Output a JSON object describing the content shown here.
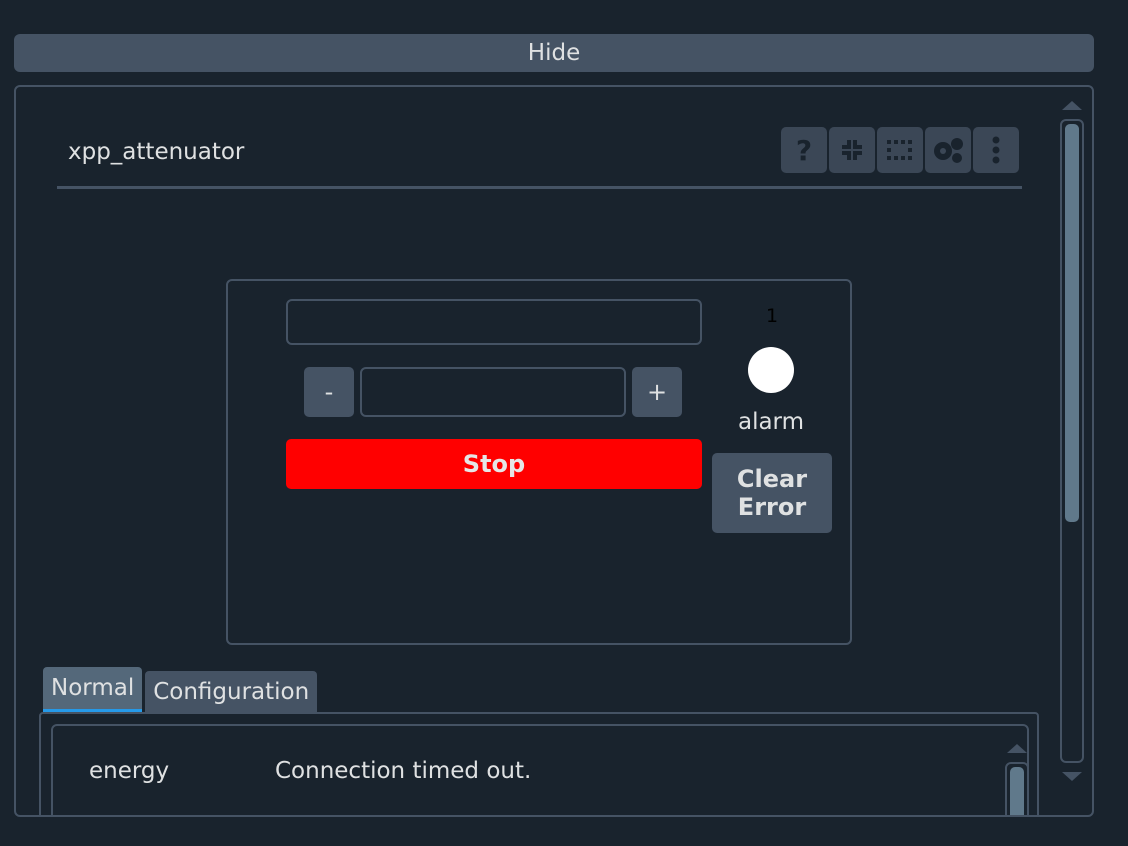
{
  "hide_button": {
    "label": "Hide"
  },
  "device": {
    "title": "xpp_attenuator",
    "tool_icons": [
      "help-icon",
      "collapse-icon",
      "grid-icon",
      "settings-icon",
      "more-vertical-icon"
    ]
  },
  "controls": {
    "readback_value": "",
    "setpoint_value": "",
    "decrement_label": "-",
    "increment_label": "+",
    "stop_label": "Stop",
    "alarm_count": "1",
    "alarm_label": "alarm",
    "clear_error_label": "Clear Error"
  },
  "tabs": [
    {
      "label": "Normal",
      "active": true
    },
    {
      "label": "Configuration",
      "active": false
    }
  ],
  "normal_tab": {
    "rows": [
      {
        "name": "energy",
        "value": "Connection timed out."
      }
    ]
  },
  "colors": {
    "background": "#19232d",
    "panel_border": "#455364",
    "button": "#455364",
    "stop": "#ff0000",
    "tab_underline": "#259ae9",
    "alarm_led": "#ffffff"
  }
}
